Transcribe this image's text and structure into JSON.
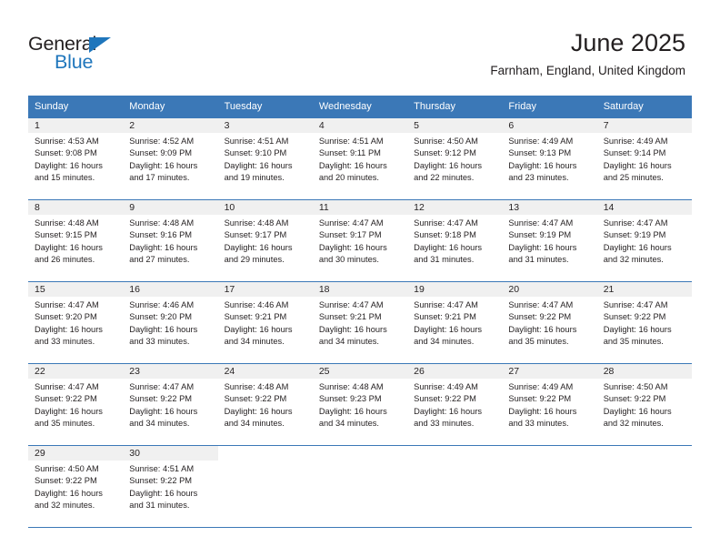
{
  "brand": {
    "name_line1": "General",
    "name_line2": "Blue",
    "logo_icon": "blue-triangle-icon",
    "color_dark": "#231f20",
    "color_blue": "#1f76bc"
  },
  "header": {
    "title": "June 2025",
    "subtitle": "Farnham, England, United Kingdom"
  },
  "theme": {
    "header_row_bg": "#3b78b7",
    "daynum_band_bg": "#f0f0f0",
    "grid_line": "#3b78b7",
    "text": "#231f20"
  },
  "weekday_headers": [
    "Sunday",
    "Monday",
    "Tuesday",
    "Wednesday",
    "Thursday",
    "Friday",
    "Saturday"
  ],
  "weeks": [
    [
      {
        "day": "1",
        "sunrise": "Sunrise: 4:53 AM",
        "sunset": "Sunset: 9:08 PM",
        "daylight_line1": "Daylight: 16 hours",
        "daylight_line2": "and 15 minutes."
      },
      {
        "day": "2",
        "sunrise": "Sunrise: 4:52 AM",
        "sunset": "Sunset: 9:09 PM",
        "daylight_line1": "Daylight: 16 hours",
        "daylight_line2": "and 17 minutes."
      },
      {
        "day": "3",
        "sunrise": "Sunrise: 4:51 AM",
        "sunset": "Sunset: 9:10 PM",
        "daylight_line1": "Daylight: 16 hours",
        "daylight_line2": "and 19 minutes."
      },
      {
        "day": "4",
        "sunrise": "Sunrise: 4:51 AM",
        "sunset": "Sunset: 9:11 PM",
        "daylight_line1": "Daylight: 16 hours",
        "daylight_line2": "and 20 minutes."
      },
      {
        "day": "5",
        "sunrise": "Sunrise: 4:50 AM",
        "sunset": "Sunset: 9:12 PM",
        "daylight_line1": "Daylight: 16 hours",
        "daylight_line2": "and 22 minutes."
      },
      {
        "day": "6",
        "sunrise": "Sunrise: 4:49 AM",
        "sunset": "Sunset: 9:13 PM",
        "daylight_line1": "Daylight: 16 hours",
        "daylight_line2": "and 23 minutes."
      },
      {
        "day": "7",
        "sunrise": "Sunrise: 4:49 AM",
        "sunset": "Sunset: 9:14 PM",
        "daylight_line1": "Daylight: 16 hours",
        "daylight_line2": "and 25 minutes."
      }
    ],
    [
      {
        "day": "8",
        "sunrise": "Sunrise: 4:48 AM",
        "sunset": "Sunset: 9:15 PM",
        "daylight_line1": "Daylight: 16 hours",
        "daylight_line2": "and 26 minutes."
      },
      {
        "day": "9",
        "sunrise": "Sunrise: 4:48 AM",
        "sunset": "Sunset: 9:16 PM",
        "daylight_line1": "Daylight: 16 hours",
        "daylight_line2": "and 27 minutes."
      },
      {
        "day": "10",
        "sunrise": "Sunrise: 4:48 AM",
        "sunset": "Sunset: 9:17 PM",
        "daylight_line1": "Daylight: 16 hours",
        "daylight_line2": "and 29 minutes."
      },
      {
        "day": "11",
        "sunrise": "Sunrise: 4:47 AM",
        "sunset": "Sunset: 9:17 PM",
        "daylight_line1": "Daylight: 16 hours",
        "daylight_line2": "and 30 minutes."
      },
      {
        "day": "12",
        "sunrise": "Sunrise: 4:47 AM",
        "sunset": "Sunset: 9:18 PM",
        "daylight_line1": "Daylight: 16 hours",
        "daylight_line2": "and 31 minutes."
      },
      {
        "day": "13",
        "sunrise": "Sunrise: 4:47 AM",
        "sunset": "Sunset: 9:19 PM",
        "daylight_line1": "Daylight: 16 hours",
        "daylight_line2": "and 31 minutes."
      },
      {
        "day": "14",
        "sunrise": "Sunrise: 4:47 AM",
        "sunset": "Sunset: 9:19 PM",
        "daylight_line1": "Daylight: 16 hours",
        "daylight_line2": "and 32 minutes."
      }
    ],
    [
      {
        "day": "15",
        "sunrise": "Sunrise: 4:47 AM",
        "sunset": "Sunset: 9:20 PM",
        "daylight_line1": "Daylight: 16 hours",
        "daylight_line2": "and 33 minutes."
      },
      {
        "day": "16",
        "sunrise": "Sunrise: 4:46 AM",
        "sunset": "Sunset: 9:20 PM",
        "daylight_line1": "Daylight: 16 hours",
        "daylight_line2": "and 33 minutes."
      },
      {
        "day": "17",
        "sunrise": "Sunrise: 4:46 AM",
        "sunset": "Sunset: 9:21 PM",
        "daylight_line1": "Daylight: 16 hours",
        "daylight_line2": "and 34 minutes."
      },
      {
        "day": "18",
        "sunrise": "Sunrise: 4:47 AM",
        "sunset": "Sunset: 9:21 PM",
        "daylight_line1": "Daylight: 16 hours",
        "daylight_line2": "and 34 minutes."
      },
      {
        "day": "19",
        "sunrise": "Sunrise: 4:47 AM",
        "sunset": "Sunset: 9:21 PM",
        "daylight_line1": "Daylight: 16 hours",
        "daylight_line2": "and 34 minutes."
      },
      {
        "day": "20",
        "sunrise": "Sunrise: 4:47 AM",
        "sunset": "Sunset: 9:22 PM",
        "daylight_line1": "Daylight: 16 hours",
        "daylight_line2": "and 35 minutes."
      },
      {
        "day": "21",
        "sunrise": "Sunrise: 4:47 AM",
        "sunset": "Sunset: 9:22 PM",
        "daylight_line1": "Daylight: 16 hours",
        "daylight_line2": "and 35 minutes."
      }
    ],
    [
      {
        "day": "22",
        "sunrise": "Sunrise: 4:47 AM",
        "sunset": "Sunset: 9:22 PM",
        "daylight_line1": "Daylight: 16 hours",
        "daylight_line2": "and 35 minutes."
      },
      {
        "day": "23",
        "sunrise": "Sunrise: 4:47 AM",
        "sunset": "Sunset: 9:22 PM",
        "daylight_line1": "Daylight: 16 hours",
        "daylight_line2": "and 34 minutes."
      },
      {
        "day": "24",
        "sunrise": "Sunrise: 4:48 AM",
        "sunset": "Sunset: 9:22 PM",
        "daylight_line1": "Daylight: 16 hours",
        "daylight_line2": "and 34 minutes."
      },
      {
        "day": "25",
        "sunrise": "Sunrise: 4:48 AM",
        "sunset": "Sunset: 9:23 PM",
        "daylight_line1": "Daylight: 16 hours",
        "daylight_line2": "and 34 minutes."
      },
      {
        "day": "26",
        "sunrise": "Sunrise: 4:49 AM",
        "sunset": "Sunset: 9:22 PM",
        "daylight_line1": "Daylight: 16 hours",
        "daylight_line2": "and 33 minutes."
      },
      {
        "day": "27",
        "sunrise": "Sunrise: 4:49 AM",
        "sunset": "Sunset: 9:22 PM",
        "daylight_line1": "Daylight: 16 hours",
        "daylight_line2": "and 33 minutes."
      },
      {
        "day": "28",
        "sunrise": "Sunrise: 4:50 AM",
        "sunset": "Sunset: 9:22 PM",
        "daylight_line1": "Daylight: 16 hours",
        "daylight_line2": "and 32 minutes."
      }
    ],
    [
      {
        "day": "29",
        "sunrise": "Sunrise: 4:50 AM",
        "sunset": "Sunset: 9:22 PM",
        "daylight_line1": "Daylight: 16 hours",
        "daylight_line2": "and 32 minutes."
      },
      {
        "day": "30",
        "sunrise": "Sunrise: 4:51 AM",
        "sunset": "Sunset: 9:22 PM",
        "daylight_line1": "Daylight: 16 hours",
        "daylight_line2": "and 31 minutes."
      },
      {
        "day": "",
        "sunrise": "",
        "sunset": "",
        "daylight_line1": "",
        "daylight_line2": "",
        "empty": true
      },
      {
        "day": "",
        "sunrise": "",
        "sunset": "",
        "daylight_line1": "",
        "daylight_line2": "",
        "empty": true
      },
      {
        "day": "",
        "sunrise": "",
        "sunset": "",
        "daylight_line1": "",
        "daylight_line2": "",
        "empty": true
      },
      {
        "day": "",
        "sunrise": "",
        "sunset": "",
        "daylight_line1": "",
        "daylight_line2": "",
        "empty": true
      },
      {
        "day": "",
        "sunrise": "",
        "sunset": "",
        "daylight_line1": "",
        "daylight_line2": "",
        "empty": true
      }
    ]
  ]
}
